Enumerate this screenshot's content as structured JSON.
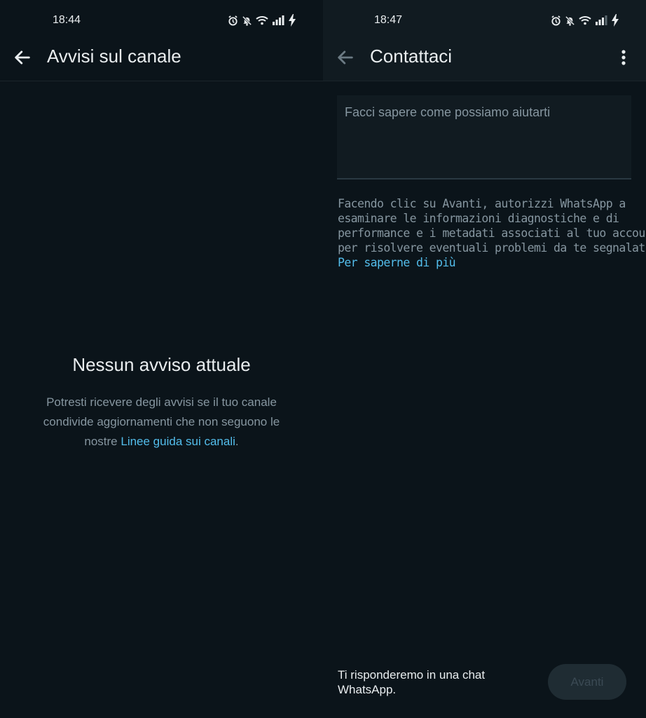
{
  "left_screen": {
    "status_time": "18:44",
    "title": "Avvisi sul canale",
    "empty_title": "Nessun avviso attuale",
    "empty_desc_line1": "Potresti ricevere degli avvisi se il tuo canale",
    "empty_desc_line2": "condivide aggiornamenti che non seguono le",
    "empty_desc_line3_prefix": "nostre ",
    "empty_desc_link": "Linee guida sui canali",
    "empty_desc_suffix": ".",
    "status_icons": [
      "alarm-icon",
      "mute-icon",
      "wifi-icon",
      "signal-icon",
      "charging-icon"
    ]
  },
  "right_screen": {
    "status_time": "18:47",
    "title": "Contattaci",
    "input_placeholder": "Facci sapere come possiamo aiutarti",
    "disclaimer_lines": [
      "Facendo clic su Avanti, autorizzi WhatsApp a",
      "esaminare le informazioni diagnostiche e di",
      "performance e i metadati associati al tuo account",
      "per risolvere eventuali problemi da te segnalati."
    ],
    "learn_more": "Per saperne di più",
    "footer_text_line1": "Ti risponderemo in una chat",
    "footer_text_line2": "WhatsApp.",
    "next_button": "Avanti",
    "status_icons": [
      "alarm-icon",
      "mute-icon",
      "wifi-icon",
      "signal-icon",
      "charging-icon"
    ]
  },
  "colors": {
    "background": "#0b141a",
    "appbar": "#111b21",
    "accent_link": "#53bdeb",
    "secondary_text": "#8696a0",
    "primary_text": "#e9edef",
    "disabled_button": "#1f2c33"
  }
}
